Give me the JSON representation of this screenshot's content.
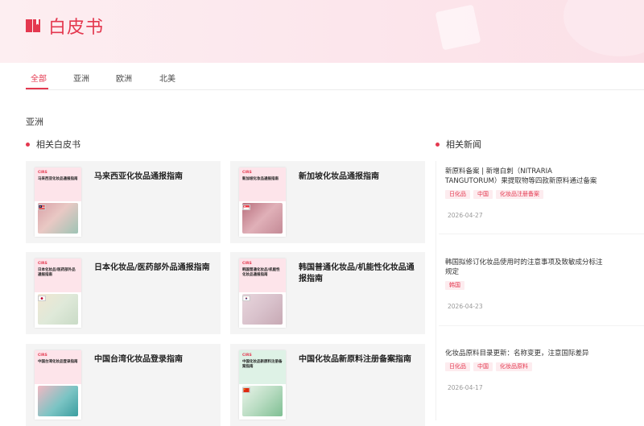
{
  "header": {
    "title": "白皮书",
    "icon": "book-icon",
    "accent": "#e4384f"
  },
  "tabs": [
    {
      "label": "全部",
      "active": true
    },
    {
      "label": "亚洲",
      "active": false
    },
    {
      "label": "欧洲",
      "active": false
    },
    {
      "label": "北美",
      "active": false
    }
  ],
  "region": {
    "title": "亚洲"
  },
  "whitepapers": {
    "heading": "相关白皮书",
    "cover_brand": "CIRS",
    "items": [
      {
        "title": "马来西亚化妆品通报指南",
        "cover_text": "马来西亚化妆品通报指南",
        "flag": "malaysia-flag"
      },
      {
        "title": "新加坡化妆品通报指南",
        "cover_text": "新加坡化妆品通报指南",
        "flag": "singapore-flag"
      },
      {
        "title": "日本化妆品/医药部外品通报指南",
        "cover_text": "日本化妆品/医药部外品通报指南",
        "flag": "japan-flag"
      },
      {
        "title": "韩国普通化妆品/机能性化妆品通报指南",
        "cover_text": "韩国普通化妆品/机能性化妆品通报指南",
        "flag": "korea-flag"
      },
      {
        "title": "中国台湾化妆品登录指南",
        "cover_text": "中国台湾化妆品登录指南",
        "flag": ""
      },
      {
        "title": "中国化妆品新原料注册备案指南",
        "cover_text": "中国化妆品新原料注册备案指南",
        "flag": "china-flag"
      }
    ]
  },
  "news": {
    "heading": "相关新闻",
    "items": [
      {
        "title": "新原料备案 | 新增白刺（NITRARIA TANGUTORUM）果提取物等四款新原料通过备案",
        "tags": [
          "日化品",
          "中国",
          "化妆品注册备案"
        ],
        "date": "2026-04-27"
      },
      {
        "title": "韩国拟修订化妆品使用时的注意事项及致敏成分标注规定",
        "tags": [
          "韩国"
        ],
        "date": "2026-04-23"
      },
      {
        "title": "化妆品原料目录更新：名称变更，注意国际差异",
        "tags": [
          "日化品",
          "中国",
          "化妆品原料"
        ],
        "date": "2026-04-17"
      }
    ]
  }
}
